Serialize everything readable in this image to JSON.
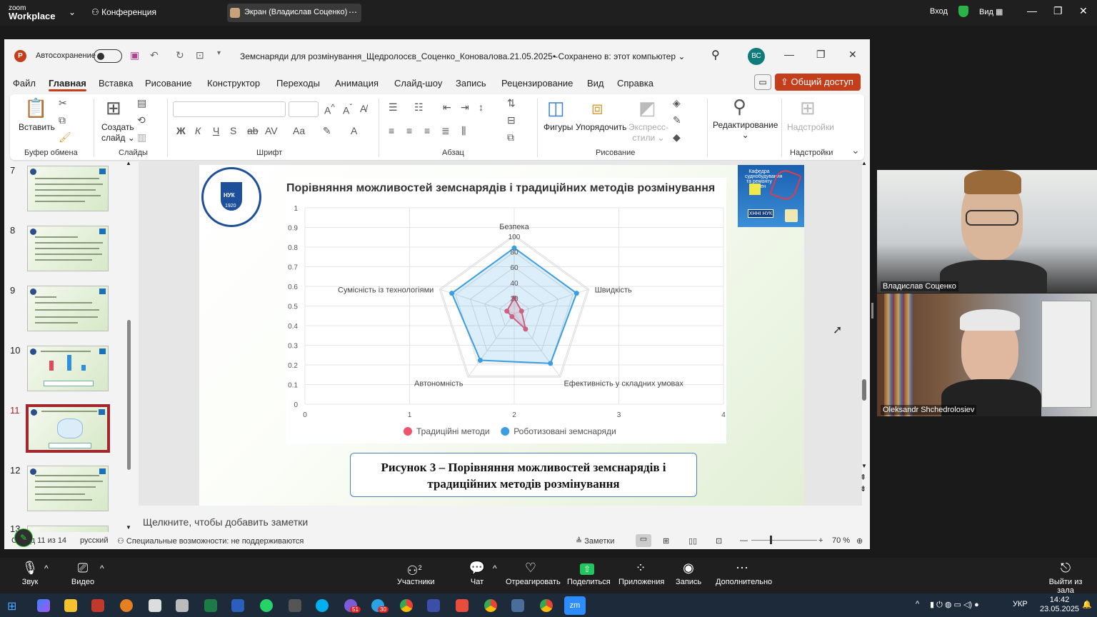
{
  "zoom_top": {
    "logo_line1": "zoom",
    "logo_line2": "Workplace",
    "meeting": "Конференция",
    "screen_share": "Экран (Владислав Соценко)",
    "signin": "Вход",
    "view": "Вид"
  },
  "ppt": {
    "autosave": "Автосохранение",
    "title": "Земснаряди для розмінування_Щедролосєв_Соценко_Коновалова.21.05.2025  -",
    "saved": "• Сохранено в: этот компьютер",
    "user_initials": "ВС",
    "tabs": [
      "Файл",
      "Главная",
      "Вставка",
      "Рисование",
      "Конструктор",
      "Переходы",
      "Анимация",
      "Слайд-шоу",
      "Запись",
      "Рецензирование",
      "Вид",
      "Справка"
    ],
    "share": "Общий доступ",
    "ribbon": {
      "paste": "Вставить",
      "new_slide_1": "Создать",
      "new_slide_2": "слайд",
      "shapes": "Фигуры",
      "arrange": "Упорядочить",
      "quick_styles_1": "Экспресс-",
      "quick_styles_2": "стили",
      "editing": "Редактирование",
      "addins": "Надстройки",
      "groups": [
        "Буфер обмена",
        "Слайды",
        "Шрифт",
        "Абзац",
        "Рисование",
        "Надстройки"
      ]
    },
    "slide_numbers": [
      "7",
      "8",
      "9",
      "10",
      "11",
      "12",
      "13"
    ],
    "notes_placeholder": "Щелкните, чтобы добавить заметки",
    "status": {
      "slide": "Слайд 11 из 14",
      "language": "русский",
      "accessibility": "Специальные возможности: не поддерживаются",
      "notes": "Заметки",
      "zoom": "70 %"
    }
  },
  "slide": {
    "uni_abbr": "НУК",
    "uni_year": "1920",
    "kaf_text": "Кафедра суднобудування та ремонту суден",
    "kaf_label": "ХННІ НУК",
    "caption": "Рисунок 3 – Порівняння можливостей земснарядів і традиційних методів розмінування"
  },
  "chart_data": {
    "type": "radar",
    "title": "Порівняння можливостей земснарядів і традиційних методів розмінування",
    "axes": [
      "Безпека",
      "Швидкість",
      "Ефективність у складних умовах",
      "Автономність",
      "Сумісність із технологіями"
    ],
    "radial_ticks": [
      "20",
      "40",
      "60",
      "80",
      "100"
    ],
    "radial_range": [
      0,
      100
    ],
    "series": [
      {
        "name": "Традиційні методи",
        "color": "#f0536e",
        "values": [
          20,
          10,
          25,
          5,
          10
        ]
      },
      {
        "name": "Роботизовані земснаряди",
        "color": "#3a9ee0",
        "values": [
          85,
          85,
          80,
          75,
          85
        ]
      }
    ],
    "cartesian_overlay": {
      "x_ticks": [
        "0",
        "1",
        "2",
        "3",
        "4"
      ],
      "y_ticks": [
        "0",
        "0.1",
        "0.2",
        "0.3",
        "0.4",
        "0.5",
        "0.6",
        "0.7",
        "0.8",
        "0.9",
        "1"
      ]
    },
    "legend_position": "bottom"
  },
  "participants": [
    {
      "name": "Владислав Соценко"
    },
    {
      "name": "Oleksandr Shchedrolosiev"
    }
  ],
  "zoom_bar": {
    "audio": "Звук",
    "video": "Видео",
    "participants": "Участники",
    "participants_count": "2",
    "chat": "Чат",
    "react": "Отреагировать",
    "share": "Поделиться",
    "apps": "Приложения",
    "record": "Запись",
    "more": "Дополнительно",
    "leave": "Выйти из зала"
  },
  "taskbar": {
    "lang": "УКР",
    "time": "14:42",
    "date": "23.05.2025",
    "badge_1": "51",
    "badge_2": "30"
  }
}
